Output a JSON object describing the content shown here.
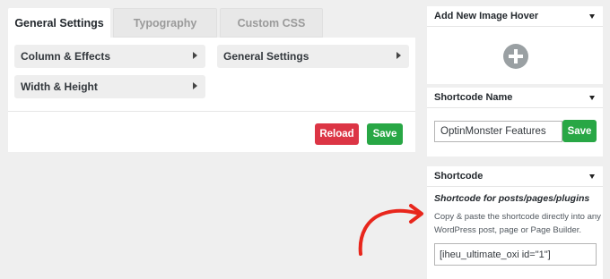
{
  "tabs": {
    "general": "General Settings",
    "typography": "Typography",
    "custom_css": "Custom CSS"
  },
  "accordions": {
    "column_effects": "Column & Effects",
    "width_height": "Width & Height",
    "general_settings": "General Settings"
  },
  "actions": {
    "reload": "Reload",
    "save": "Save"
  },
  "add_hover": {
    "title": "Add New Image Hover"
  },
  "shortcode_name": {
    "title": "Shortcode Name",
    "value": "OptinMonster Features",
    "save": "Save"
  },
  "shortcode": {
    "title": "Shortcode",
    "subtitle": "Shortcode for posts/pages/plugins",
    "description": "Copy & paste the shortcode directly into any WordPress post, page or Page Builder.",
    "value": "[iheu_ultimate_oxi id=\"1\"]"
  },
  "colors": {
    "reload": "#dc3545",
    "save": "#28a745",
    "annotation_arrow": "#e8261c"
  }
}
